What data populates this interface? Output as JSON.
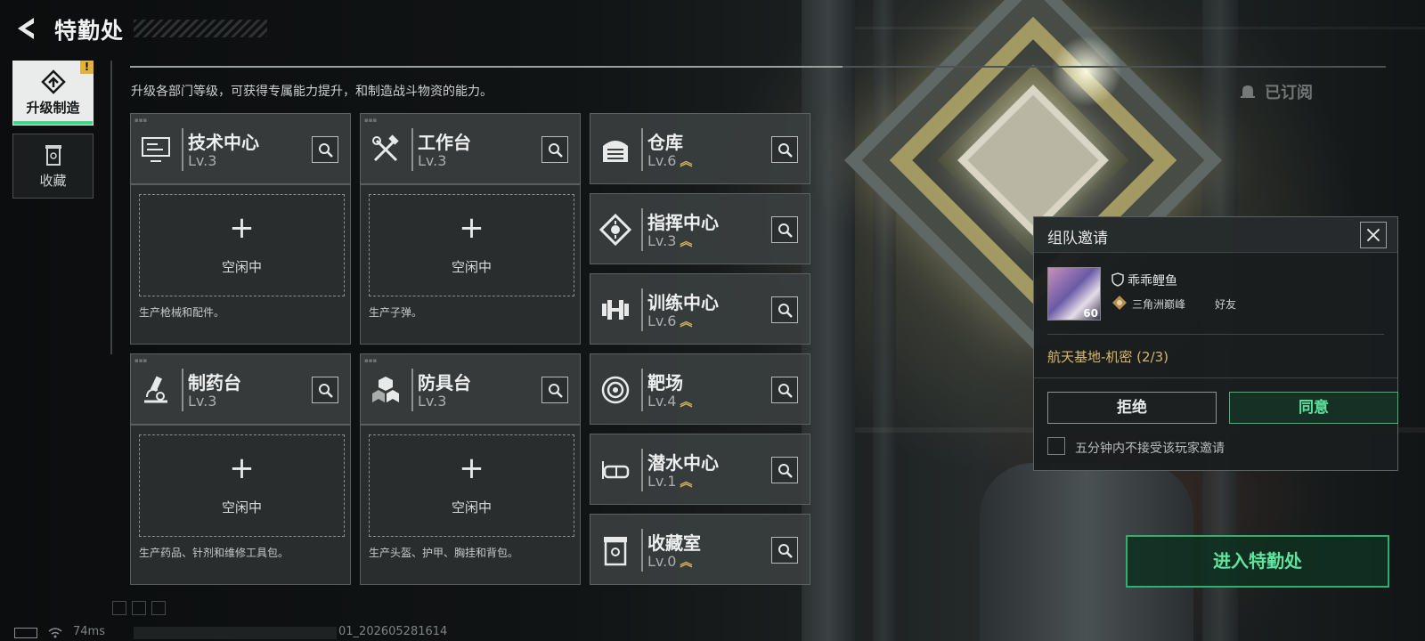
{
  "header": {
    "title": "特勤处"
  },
  "sidenav": {
    "items": [
      {
        "label": "升级制造",
        "active": true,
        "badge": "!"
      },
      {
        "label": "收藏",
        "active": false
      }
    ]
  },
  "intro": "升级各部门等级，可获得专属能力提升，和制造战斗物资的能力。",
  "subscribed": "已订阅",
  "production": [
    {
      "name": "技术中心",
      "level": "Lv.3",
      "slot_label": "空闲中",
      "desc": "生产枪械和配件。",
      "icon": "monitor-icon"
    },
    {
      "name": "工作台",
      "level": "Lv.3",
      "slot_label": "空闲中",
      "desc": "生产子弹。",
      "icon": "tools-icon"
    },
    {
      "name": "制药台",
      "level": "Lv.3",
      "slot_label": "空闲中",
      "desc": "生产药品、针剂和维修工具包。",
      "icon": "microscope-icon"
    },
    {
      "name": "防具台",
      "level": "Lv.3",
      "slot_label": "空闲中",
      "desc": "生产头盔、护甲、胸挂和背包。",
      "icon": "armor-icon"
    }
  ],
  "facilities": [
    {
      "name": "仓库",
      "level": "Lv.6",
      "icon": "warehouse-icon"
    },
    {
      "name": "指挥中心",
      "level": "Lv.3",
      "icon": "chip-icon"
    },
    {
      "name": "训练中心",
      "level": "Lv.6",
      "icon": "dumbbell-icon"
    },
    {
      "name": "靶场",
      "level": "Lv.4",
      "icon": "target-icon"
    },
    {
      "name": "潜水中心",
      "level": "Lv.1",
      "icon": "diving-mask-icon"
    },
    {
      "name": "收藏室",
      "level": "Lv.0",
      "icon": "collection-icon"
    }
  ],
  "invite": {
    "title": "组队邀请",
    "player_name": "乖乖鲤鱼",
    "player_level": "60",
    "rank": "三角洲巅峰",
    "relation": "好友",
    "mission": "航天基地-机密 (2/3)",
    "reject_label": "拒绝",
    "accept_label": "同意",
    "mute_label": "五分钟内不接受该玩家邀请"
  },
  "enter_label": "进入特勤处",
  "status": {
    "ping": "74ms",
    "session": "01_202605281614"
  },
  "colors": {
    "accent_green": "#3fd88a",
    "upgrade_gold": "#d9b45a",
    "warning": "#e2b23b"
  }
}
